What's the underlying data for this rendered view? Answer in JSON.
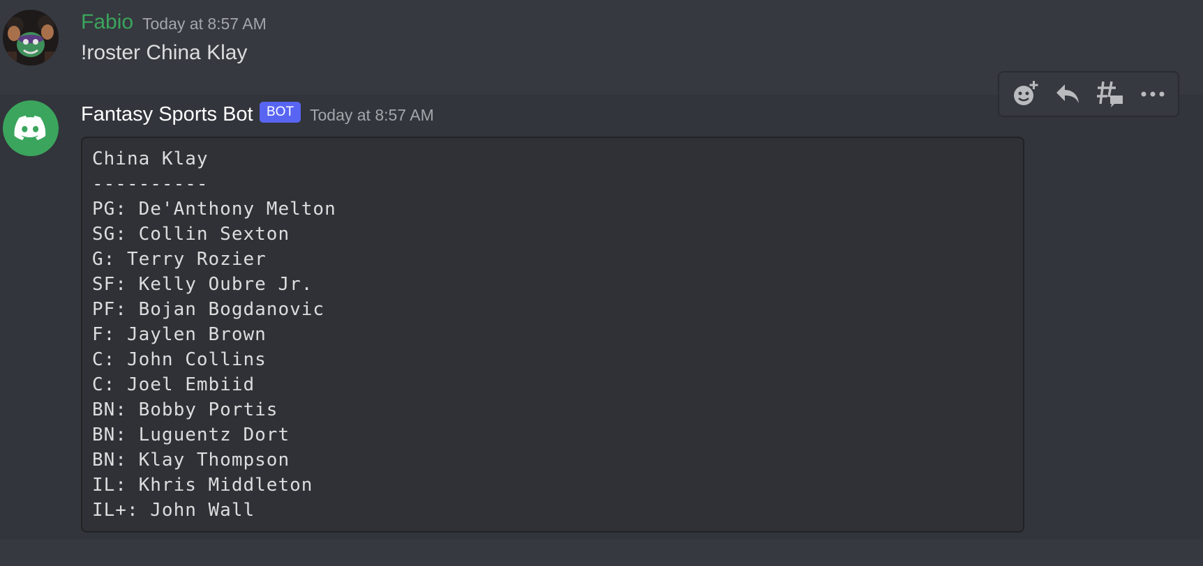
{
  "messages": [
    {
      "author": "Fabio",
      "author_color": "#3ba55d",
      "timestamp": "Today at 8:57 AM",
      "content": "!roster China Klay",
      "avatar": "cartoon-avatar"
    },
    {
      "author": "Fantasy Sports Bot",
      "author_color": "#ffffff",
      "badge": "BOT",
      "timestamp": "Today at 8:57 AM",
      "avatar": "discord-logo-icon",
      "code_lines": [
        "China Klay",
        "----------",
        "PG: De'Anthony Melton",
        "SG: Collin Sexton",
        "G: Terry Rozier",
        "SF: Kelly Oubre Jr.",
        "PF: Bojan Bogdanovic",
        "F: Jaylen Brown",
        "C: John Collins",
        "C: Joel Embiid",
        "BN: Bobby Portis",
        "BN: Luguentz Dort",
        "BN: Klay Thompson",
        "IL: Khris Middleton",
        "IL+: John Wall"
      ]
    }
  ],
  "toolbar": {
    "buttons": [
      "add-reaction-icon",
      "reply-icon",
      "create-thread-icon",
      "more-options-icon"
    ]
  },
  "colors": {
    "background": "#36393f",
    "hover_background": "#32353b",
    "code_background": "#2f3136",
    "bot_badge": "#5865f2",
    "bot_avatar": "#3ba55d"
  }
}
